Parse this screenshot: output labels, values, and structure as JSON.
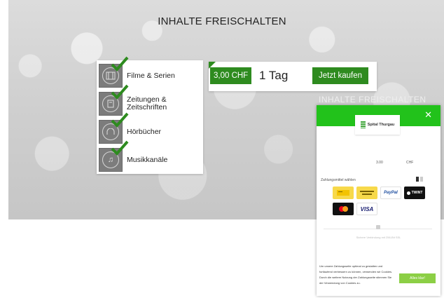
{
  "page": {
    "title": "INHALTE FREISCHALTEN"
  },
  "categories": [
    {
      "label": "Filme & Serien",
      "icon": "film-icon"
    },
    {
      "label": "Zeitungen &\nZeitschriften",
      "icon": "newspaper-icon"
    },
    {
      "label": "Hörbücher",
      "icon": "headphones-icon"
    },
    {
      "label": "Musikkanäle",
      "icon": "music-note-icon"
    }
  ],
  "offer": {
    "price": "3,00 CHF",
    "duration": "1 Tag",
    "buy_label": "Jetzt kaufen"
  },
  "background_text": "INHALTE FREISCHALTEN",
  "payment_modal": {
    "brand": "Spital Thurgau",
    "close_symbol": "✕",
    "amount": "3.00",
    "currency": "CHF",
    "payment_label": "Zahlungsmittel wählen",
    "methods": {
      "paypal": "PayPal",
      "twint": "TWINT",
      "visa": "VISA"
    },
    "secure_text": "Sichere Verbindung mit 256-Bit SSL",
    "cookie_text": "Um unsere Zahlungsseite optimal zu gestalten und fortlaufend verbessern zu können, verwenden wir Cookies. Durch die weitere Nutzung der Zahlungsseite stimmen Sie der Verwendung von Cookies zu.",
    "cookie_button": "Alles klar!"
  },
  "colors": {
    "accent_green": "#2e8b1f",
    "modal_green": "#22c21b",
    "cookie_button": "#8ccf45"
  }
}
